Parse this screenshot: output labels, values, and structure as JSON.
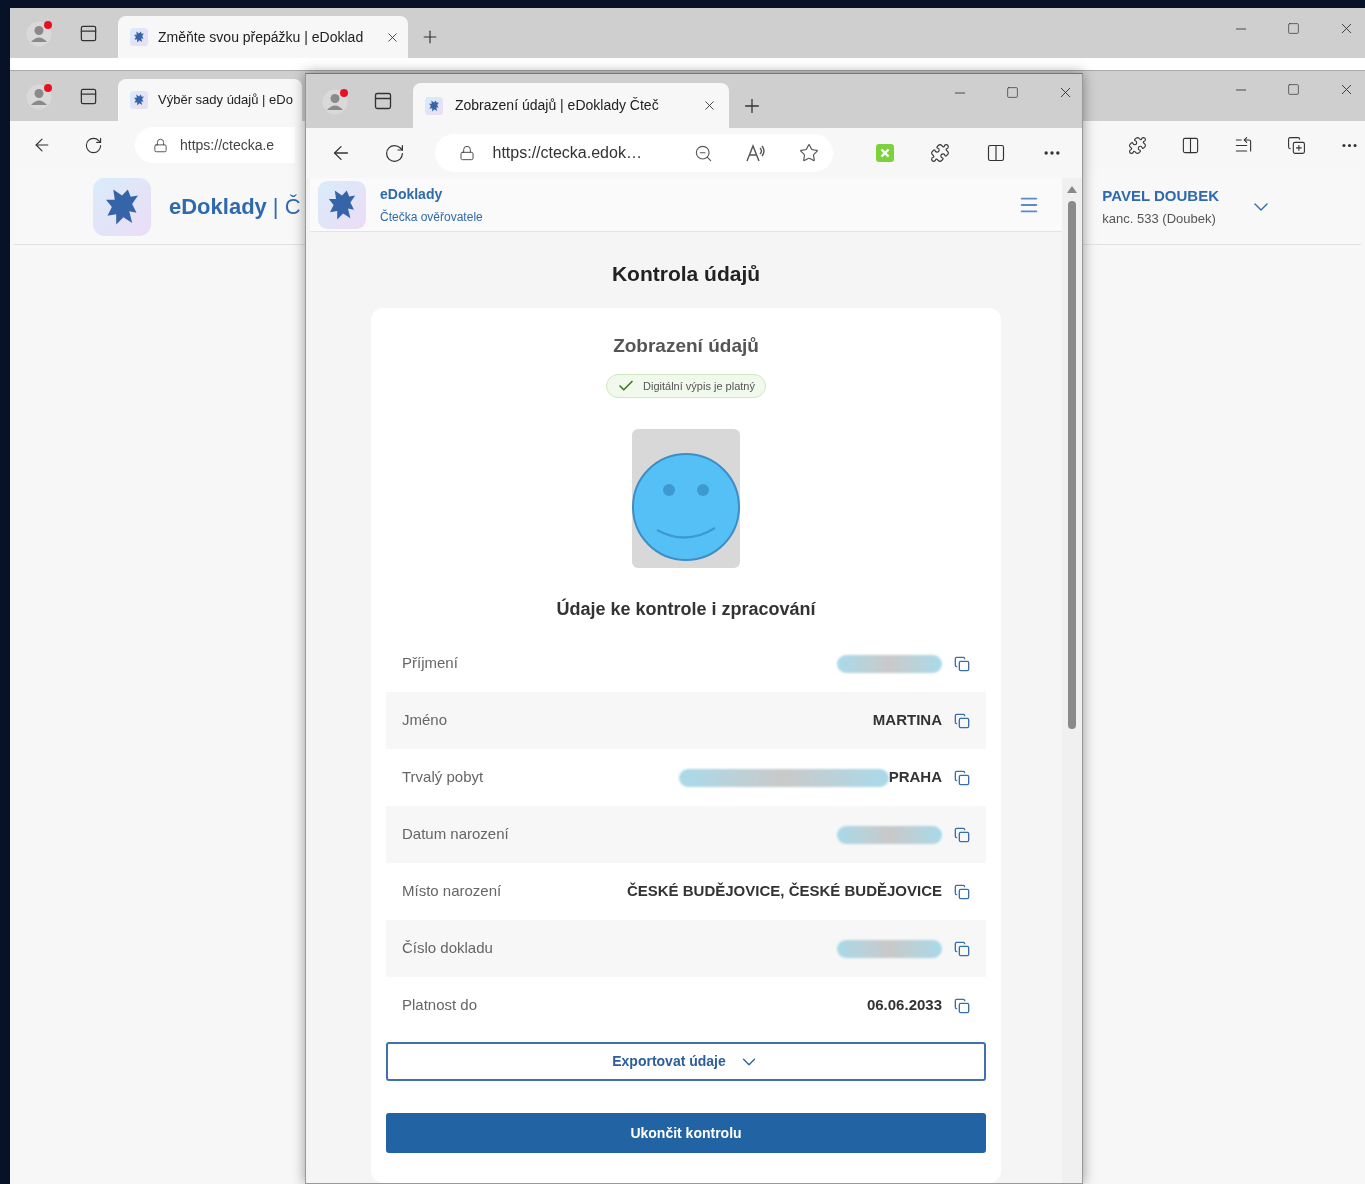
{
  "back_window": {
    "tab_title": "Změňte svou přepážku | eDoklad"
  },
  "middle_window": {
    "tab_title": "Výběr sady údajů | eDo",
    "address": "https://ctecka.e",
    "brand": "eDoklady",
    "brand_suffix": "| Č",
    "user_name": "PAVEL DOUBEK",
    "user_office": "kanc. 533 (Doubek)"
  },
  "front_window": {
    "tab_title": "Zobrazení údajů | eDoklady Čteč",
    "address": "https://ctecka.edok…",
    "app_name": "eDoklady",
    "app_subtitle": "Čtečka ověřovatele",
    "page_title": "Kontrola údajů",
    "card_title": "Zobrazení údajů",
    "status_badge": "Digitální výpis je platný",
    "section_title": "Údaje ke kontrole i zpracování",
    "fields": [
      {
        "label": "Příjmení",
        "kind": "redacted"
      },
      {
        "label": "Jméno",
        "kind": "text",
        "value": "MARTINA"
      },
      {
        "label": "Trvalý pobyt",
        "kind": "partial",
        "value": "PRAHA"
      },
      {
        "label": "Datum narození",
        "kind": "redacted"
      },
      {
        "label": "Místo narození",
        "kind": "text",
        "value": "ČESKÉ BUDĚJOVICE, ČESKÉ BUDĚJOVICE"
      },
      {
        "label": "Číslo dokladu",
        "kind": "redacted"
      },
      {
        "label": "Platnost do",
        "kind": "text",
        "value": "06.06.2033"
      }
    ],
    "export_button": "Exportovat údaje",
    "finish_button": "Ukončit kontrolu"
  }
}
